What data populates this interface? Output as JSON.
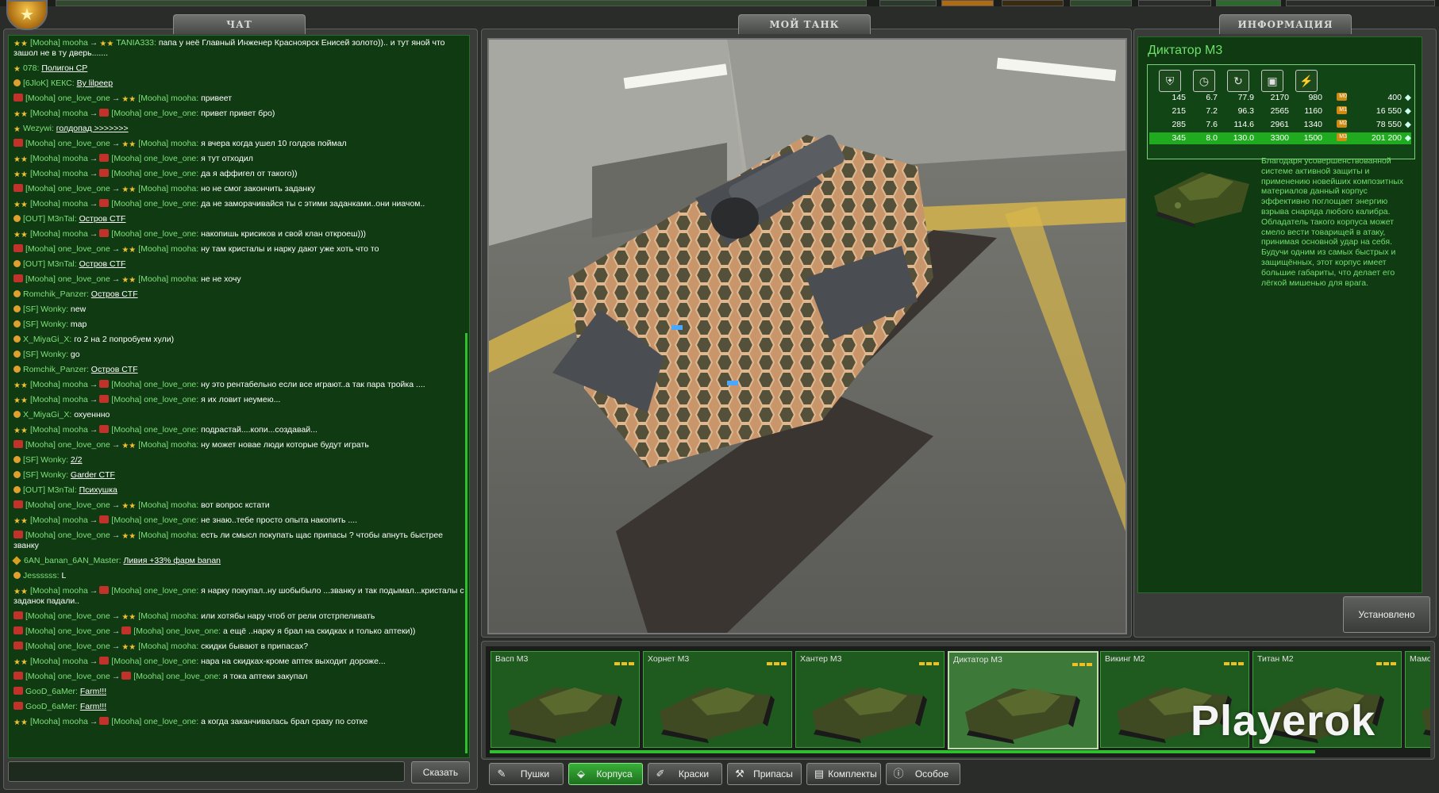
{
  "tabs": {
    "chat": "ЧАТ",
    "my_tank": "МОЙ ТАНК",
    "info": "ИНФОРМАЦИЯ"
  },
  "chat": {
    "lines": [
      {
        "icons": "ss",
        "from": "[Mooha] mooha",
        "arrow": "→",
        "icon2": "ss",
        "to": "TANIA333:",
        "text": "папа у неё Главный Инженер Красноярск Енисей золото)).. и тут яной что зашол не в ту дверь.......",
        "link": false
      },
      {
        "icons": "s",
        "from": "078:",
        "arrow": "",
        "icon2": "",
        "to": "",
        "text": "Полигон CP",
        "link": true
      },
      {
        "icons": "o",
        "from": "[6JloK] КЕКС:",
        "arrow": "",
        "icon2": "",
        "to": "",
        "text": "By lilpeep",
        "link": true
      },
      {
        "icons": "r",
        "from": "[Mooha] one_love_one",
        "arrow": "→",
        "icon2": "ss",
        "to": "[Mooha] mooha:",
        "text": "привеет",
        "link": false
      },
      {
        "icons": "ss",
        "from": "[Mooha] mooha",
        "arrow": "→",
        "icon2": "r",
        "to": "[Mooha] one_love_one:",
        "text": "привет привет бро)",
        "link": false
      },
      {
        "icons": "s",
        "from": "Wezywi:",
        "arrow": "",
        "icon2": "",
        "to": "",
        "text": "голдопад                   >>>>>>>",
        "link": true
      },
      {
        "icons": "r",
        "from": "[Mooha] one_love_one",
        "arrow": "→",
        "icon2": "ss",
        "to": "[Mooha] mooha:",
        "text": "я вчера когда ушел 10 голдов поймал",
        "link": false
      },
      {
        "icons": "ss",
        "from": "[Mooha] mooha",
        "arrow": "→",
        "icon2": "r",
        "to": "[Mooha] one_love_one:",
        "text": "я тут отходил",
        "link": false
      },
      {
        "icons": "ss",
        "from": "[Mooha] mooha",
        "arrow": "→",
        "icon2": "r",
        "to": "[Mooha] one_love_one:",
        "text": "да я аффигел от такого))",
        "link": false
      },
      {
        "icons": "r",
        "from": "[Mooha] one_love_one",
        "arrow": "→",
        "icon2": "ss",
        "to": "[Mooha] mooha:",
        "text": "но не смог закончить заданку",
        "link": false
      },
      {
        "icons": "ss",
        "from": "[Mooha] mooha",
        "arrow": "→",
        "icon2": "r",
        "to": "[Mooha] one_love_one:",
        "text": "да не заморачивайся ты с этими заданками..они ниачом..",
        "link": false
      },
      {
        "icons": "o",
        "from": "[OUT] M3nTal:",
        "arrow": "",
        "icon2": "",
        "to": "",
        "text": "Остров CTF",
        "link": true
      },
      {
        "icons": "ss",
        "from": "[Mooha] mooha",
        "arrow": "→",
        "icon2": "r",
        "to": "[Mooha] one_love_one:",
        "text": "накопишь крисиков и свой клан откроеш)))",
        "link": false
      },
      {
        "icons": "r",
        "from": "[Mooha] one_love_one",
        "arrow": "→",
        "icon2": "ss",
        "to": "[Mooha] mooha:",
        "text": "ну там кристалы и нарку дают уже хоть что то",
        "link": false
      },
      {
        "icons": "o",
        "from": "[OUT] M3nTal:",
        "arrow": "",
        "icon2": "",
        "to": "",
        "text": "Остров CTF",
        "link": true
      },
      {
        "icons": "r",
        "from": "[Mooha] one_love_one",
        "arrow": "→",
        "icon2": "ss",
        "to": "[Mooha] mooha:",
        "text": "не не хочу",
        "link": false
      },
      {
        "icons": "o",
        "from": "Romchik_Panzer:",
        "arrow": "",
        "icon2": "",
        "to": "",
        "text": "Остров CTF",
        "link": true
      },
      {
        "icons": "o",
        "from": "[SF] Wonky:",
        "arrow": "",
        "icon2": "",
        "to": "",
        "text": "new",
        "link": false
      },
      {
        "icons": "o",
        "from": "[SF] Wonky:",
        "arrow": "",
        "icon2": "",
        "to": "",
        "text": "map",
        "link": false
      },
      {
        "icons": "o",
        "from": "X_MiyaGi_X:",
        "arrow": "",
        "icon2": "",
        "to": "",
        "text": "го 2 на 2 попробуем хули)",
        "link": false
      },
      {
        "icons": "o",
        "from": "[SF] Wonky:",
        "arrow": "",
        "icon2": "",
        "to": "",
        "text": "go",
        "link": false
      },
      {
        "icons": "o",
        "from": "Romchik_Panzer:",
        "arrow": "",
        "icon2": "",
        "to": "",
        "text": "Остров CTF",
        "link": true
      },
      {
        "icons": "ss",
        "from": "[Mooha] mooha",
        "arrow": "→",
        "icon2": "r",
        "to": "[Mooha] one_love_one:",
        "text": "ну это рентабельно если все играют..а так пара тройка ....",
        "link": false
      },
      {
        "icons": "ss",
        "from": "[Mooha] mooha",
        "arrow": "→",
        "icon2": "r",
        "to": "[Mooha] one_love_one:",
        "text": "я их ловит неумею...",
        "link": false
      },
      {
        "icons": "o",
        "from": "X_MiyaGi_X:",
        "arrow": "",
        "icon2": "",
        "to": "",
        "text": "охуеннно",
        "link": false
      },
      {
        "icons": "ss",
        "from": "[Mooha] mooha",
        "arrow": "→",
        "icon2": "r",
        "to": "[Mooha] one_love_one:",
        "text": "подрастай....копи...создавай...",
        "link": false
      },
      {
        "icons": "r",
        "from": "[Mooha] one_love_one",
        "arrow": "→",
        "icon2": "ss",
        "to": "[Mooha] mooha:",
        "text": "ну может новае люди которые будут играть",
        "link": false
      },
      {
        "icons": "o",
        "from": "[SF] Wonky:",
        "arrow": "",
        "icon2": "",
        "to": "",
        "text": "2/2",
        "link": true
      },
      {
        "icons": "o",
        "from": "[SF] Wonky:",
        "arrow": "",
        "icon2": "",
        "to": "",
        "text": "Garder CTF",
        "link": true
      },
      {
        "icons": "o",
        "from": "[OUT] M3nTal:",
        "arrow": "",
        "icon2": "",
        "to": "",
        "text": "Психушка",
        "link": true
      },
      {
        "icons": "r",
        "from": "[Mooha] one_love_one",
        "arrow": "→",
        "icon2": "ss",
        "to": "[Mooha] mooha:",
        "text": "вот вопрос кстати",
        "link": false
      },
      {
        "icons": "ss",
        "from": "[Mooha] mooha",
        "arrow": "→",
        "icon2": "r",
        "to": "[Mooha] one_love_one:",
        "text": "не знаю..тебе просто опыта накопить ....",
        "link": false
      },
      {
        "icons": "r",
        "from": "[Mooha] one_love_one",
        "arrow": "→",
        "icon2": "ss",
        "to": "[Mooha] mooha:",
        "text": "есть ли смысл покупать щас припасы ? чтобы апнуть быстрее званку",
        "link": false
      },
      {
        "icons": "d",
        "from": "6AN_banan_6AN_Master:",
        "arrow": "",
        "icon2": "",
        "to": "",
        "text": "Ливия +33% фарм banan",
        "link": true
      },
      {
        "icons": "o",
        "from": "Jessssss:",
        "arrow": "",
        "icon2": "",
        "to": "",
        "text": "L",
        "link": false
      },
      {
        "icons": "ss",
        "from": "[Mooha] mooha",
        "arrow": "→",
        "icon2": "r",
        "to": "[Mooha] one_love_one:",
        "text": "я нарку покупал..ну шобыбыло ...званку и так подымал...кристалы с заданок падали..",
        "link": false
      },
      {
        "icons": "r",
        "from": "[Mooha] one_love_one",
        "arrow": "→",
        "icon2": "ss",
        "to": "[Mooha] mooha:",
        "text": "или хотябы нару чтоб от рели отстрпеливать",
        "link": false
      },
      {
        "icons": "r",
        "from": "[Mooha] one_love_one",
        "arrow": "→",
        "icon2": "r",
        "to": "[Mooha] one_love_one:",
        "text": "а ещё ..нарку я брал на скидках и только аптеки))",
        "link": false
      },
      {
        "icons": "r",
        "from": "[Mooha] one_love_one",
        "arrow": "→",
        "icon2": "ss",
        "to": "[Mooha] mooha:",
        "text": "скидки бывают в припасах?",
        "link": false
      },
      {
        "icons": "ss",
        "from": "[Mooha] mooha",
        "arrow": "→",
        "icon2": "r",
        "to": "[Mooha] one_love_one:",
        "text": "нара на скидках-кроме аптек выходит дороже...",
        "link": false
      },
      {
        "icons": "r",
        "from": "[Mooha] one_love_one",
        "arrow": "→",
        "icon2": "r",
        "to": "[Mooha] one_love_one:",
        "text": "я тока аптеки закупал",
        "link": false
      },
      {
        "icons": "r",
        "from": "GooD_6aMer:",
        "arrow": "",
        "icon2": "",
        "to": "",
        "text": "Farm!!!",
        "link": true
      },
      {
        "icons": "r",
        "from": "GooD_6aMer:",
        "arrow": "",
        "icon2": "",
        "to": "",
        "text": "Farm!!!",
        "link": true
      },
      {
        "icons": "ss",
        "from": "[Mooha] mooha",
        "arrow": "→",
        "icon2": "r",
        "to": "[Mooha] one_love_one:",
        "text": "а когда заканчивалась брал сразу по сотке",
        "link": false
      }
    ],
    "input_placeholder": "",
    "send_label": "Сказать"
  },
  "info": {
    "title": "Диктатор M3",
    "stat_icons": [
      "armor-icon",
      "speed-icon",
      "turn-icon",
      "weight-icon",
      "power-icon"
    ],
    "rows": [
      {
        "a": "145",
        "b": "6.7",
        "c": "77.9",
        "d": "2170",
        "e": "980",
        "badge": "M0",
        "price": "400",
        "selected": false
      },
      {
        "a": "215",
        "b": "7.2",
        "c": "96.3",
        "d": "2565",
        "e": "1160",
        "badge": "M1",
        "price": "16 550",
        "selected": false
      },
      {
        "a": "285",
        "b": "7.6",
        "c": "114.6",
        "d": "2961",
        "e": "1340",
        "badge": "M2",
        "price": "78 550",
        "selected": false
      },
      {
        "a": "345",
        "b": "8.0",
        "c": "130.0",
        "d": "3300",
        "e": "1500",
        "badge": "M3",
        "price": "201 200",
        "selected": true
      }
    ],
    "description": "Благодаря усовершенствованной системе активной защиты и применению новейших композитных материалов данный корпус эффективно поглощает энергию взрыва снаряда любого калибра. Обладатель такого корпуса может смело вести товарищей в атаку, принимая основной удар на себя. Будучи одним из самых быстрых и защищённых, этот корпус имеет большие габариты, что делает его лёгкой мишенью для врага.",
    "installed_label": "Установлено"
  },
  "cards": [
    {
      "name": "Васп M3",
      "selected": false
    },
    {
      "name": "Хорнет M3",
      "selected": false
    },
    {
      "name": "Хантер M3",
      "selected": false
    },
    {
      "name": "Диктатор M3",
      "selected": true
    },
    {
      "name": "Викинг M2",
      "selected": false
    },
    {
      "name": "Титан M2",
      "selected": false
    },
    {
      "name": "Мамо",
      "selected": false
    }
  ],
  "watermark": "Playerok",
  "categories": [
    {
      "label": "Пушки",
      "icon": "turret-icon",
      "active": false
    },
    {
      "label": "Корпуса",
      "icon": "hull-icon",
      "active": true
    },
    {
      "label": "Краски",
      "icon": "paint-icon",
      "active": false
    },
    {
      "label": "Припасы",
      "icon": "supplies-icon",
      "active": false
    },
    {
      "label": "Комплекты",
      "icon": "kits-icon",
      "active": false
    },
    {
      "label": "Особое",
      "icon": "special-icon",
      "active": false
    }
  ],
  "colors": {
    "accent_green": "#2fbf2f",
    "panel_green": "#0f3a12",
    "nick_green": "#7ee07a",
    "camo": "#c89a6a"
  }
}
